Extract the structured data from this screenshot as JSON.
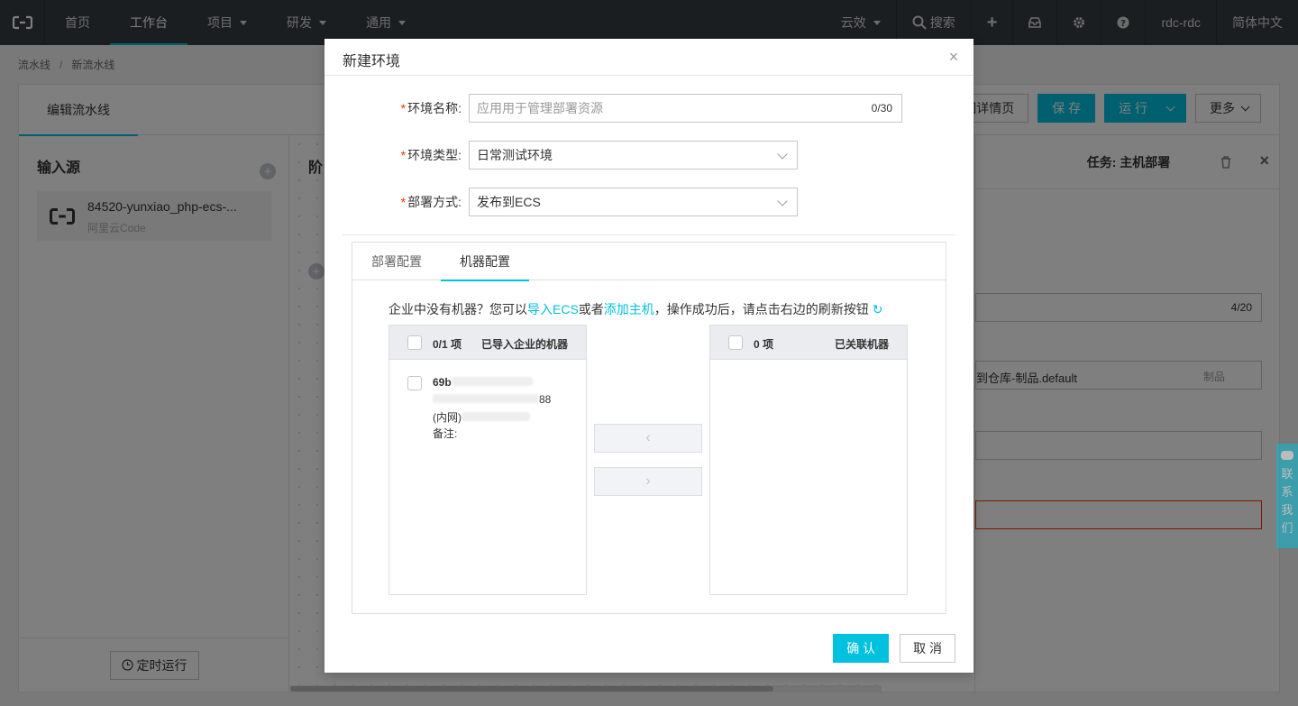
{
  "topnav": {
    "items": [
      {
        "label": "首页"
      },
      {
        "label": "工作台"
      },
      {
        "label": "项目"
      },
      {
        "label": "研发"
      },
      {
        "label": "通用"
      }
    ],
    "right": {
      "yunxiao": "云效",
      "search": "搜索",
      "user": "rdc-rdc",
      "lang": "简体中文"
    }
  },
  "breadcrumb": [
    "流水线",
    "新流水线"
  ],
  "main": {
    "tab": "编辑流水线",
    "actions": {
      "back_detail": "回详情页",
      "save": "保 存",
      "run": "运 行",
      "more": "更多"
    },
    "left": {
      "title": "输入源",
      "source_name": "84520-yunxiao_php-ecs-...",
      "source_sub": "阿里云Code",
      "timer_btn": "定时运行"
    },
    "stage_title": "阶",
    "right": {
      "task_title": "任务: 主机部署",
      "count": "4/20",
      "artifact": "到仓库-制品.default",
      "artifact_tag": "制品"
    }
  },
  "contact": [
    "联",
    "系",
    "我",
    "们"
  ],
  "dialog": {
    "title": "新建环境",
    "fields": {
      "name": {
        "label": "环境名称:",
        "placeholder": "应用用于管理部署资源",
        "count": "0/30"
      },
      "type": {
        "label": "环境类型:",
        "value": "日常测试环境"
      },
      "deploy": {
        "label": "部署方式:",
        "value": "发布到ECS"
      }
    },
    "tabs": [
      "部署配置",
      "机器配置"
    ],
    "hint": {
      "pre": "企业中没有机器？您可以",
      "link1": "导入ECS",
      "mid": "或者",
      "link2": "添加主机",
      "post": "，操作成功后，请点击右边的刷新按钮"
    },
    "transfer": {
      "left_count": "0/1 项",
      "left_title": "已导入企业的机器",
      "item": {
        "id": "69b",
        "instance_tail": "88",
        "net_label": "(内网)",
        "note_label": "备注:"
      },
      "right_count": "0 项",
      "right_title": "已关联机器"
    },
    "confirm": "确 认",
    "cancel": "取 消"
  }
}
